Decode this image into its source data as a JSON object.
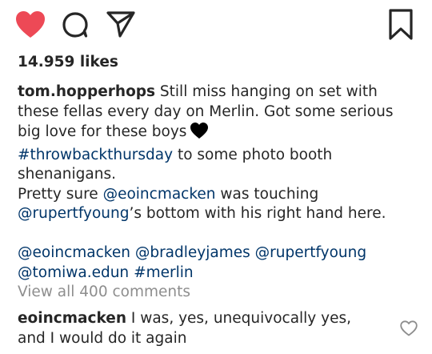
{
  "actions": {
    "heart_icon": "heart-filled-icon",
    "comment_icon": "comment-bubble-icon",
    "share_icon": "paper-plane-icon",
    "save_icon": "bookmark-icon",
    "heart_color": "#ed4956"
  },
  "post": {
    "likes": "14.959 likes",
    "caption": {
      "username": "tom.hopperhops",
      "line1_tail": " Still miss hanging on set with",
      "line2": "these fellas every day on Merlin. Got some serious",
      "line3": "big love for these boys",
      "emoji_icon": "black-heart-icon",
      "hashtag1": "#throwbackthursday",
      "hashtag1_tail": " to some photo booth",
      "line5": "shenanigans.",
      "line6_head": "Pretty sure ",
      "mention1": "@eoincmacken",
      "line6_tail": " was touching",
      "mention2": "@rupertfyoung",
      "line7_tail": "’s bottom with his right hand here.",
      "tags_line1": [
        "@eoincmacken",
        "@bradleyjames",
        "@rupertfyoung"
      ],
      "tags_line2": [
        "@tomiwa.edun",
        "#merlin"
      ]
    },
    "view_all_comments": "View all 400 comments",
    "comment": {
      "username": "eoincmacken",
      "text1": " I was, yes, unequivocally yes,",
      "text2": "and I would do it again",
      "like_icon": "heart-outline-icon"
    },
    "link_color": "#003569"
  }
}
